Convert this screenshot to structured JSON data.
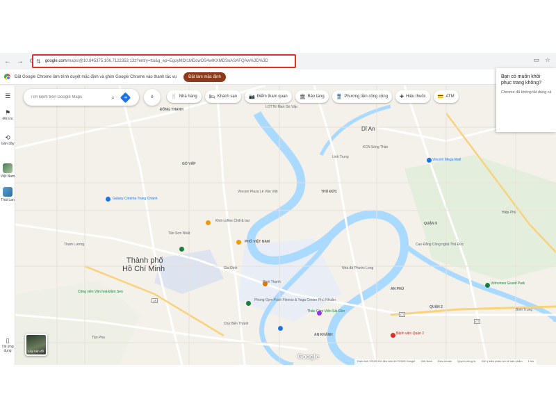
{
  "browser": {
    "url_host": "google.com",
    "url_path": "/maps/@10.845375,106.7122353,13z?entry=ttu&g_ep=EgoyMDI1MDcwOS4wIKXMDSoASAFQAw%3D%3D",
    "back_icon": "back-arrow",
    "forward_icon": "forward-arrow",
    "reload_icon": "reload",
    "site_info_icon": "tune"
  },
  "infobar": {
    "message": "Đặt Google Chrome làm trình duyệt mặc định và ghim Google Chrome vào thanh tác vụ",
    "cta_label": "Đặt làm mặc định"
  },
  "rail": {
    "menu_icon": "hamburger",
    "items": [
      {
        "label": "Đã lưu",
        "icon": "bookmark"
      },
      {
        "label": "Gần đây",
        "icon": "history"
      },
      {
        "label": "Việt Nam",
        "icon": "thumbnail"
      },
      {
        "label": "Thái Lan",
        "icon": "thumbnail"
      },
      {
        "label": "Tải ứng dụng",
        "icon": "phone"
      }
    ]
  },
  "search": {
    "placeholder": "Tìm kiếm trên Google Maps",
    "lang_chip": "ê"
  },
  "chips": [
    {
      "label": "Nhà hàng",
      "icon": "🍴"
    },
    {
      "label": "Khách sạn",
      "icon": "🛏"
    },
    {
      "label": "Điểm tham quan",
      "icon": "📷"
    },
    {
      "label": "Bảo tàng",
      "icon": "🏛"
    },
    {
      "label": "Phương tiện công cộng",
      "icon": "🚆"
    },
    {
      "label": "Hiệu thuốc",
      "icon": "✚"
    },
    {
      "label": "ATM",
      "icon": "💳"
    }
  ],
  "popup": {
    "title": "Bạn có muốn khôi phục trang không?",
    "desc": "Chrome đã không tắt đúng cách"
  },
  "layers_label": "Lớp bản đồ",
  "google_logo": "Google",
  "footer": [
    "Hình ảnh ©2025 Dữ liệu bản đồ ©2025 Google",
    "Việt Nam",
    "Điều khoản",
    "Quyền riêng tư",
    "Gửi ý kiến phản hồi về sản phẩm",
    "1 km"
  ],
  "map_labels": {
    "city": "Thành phố",
    "city2": "Hồ Chí Minh",
    "dian": "Dĩ An",
    "dong_thanh": "ĐÔNG THẠNH",
    "an_khanh": "AN KHÁNH",
    "lotte": "LOTTE Mart Gò Vấp",
    "phoviet": "PHỐ VIỆT NAM",
    "khoi": "Khói coffee Chill & bar",
    "galaxy": "Galaxy Cinema Trung Chánh",
    "vincom": "Vincom Plaza Lê Văn Việt",
    "phongdym": "Phong Gym Push Fitness & Yoga Center Phú Nhuận",
    "thaocam": "Thảo Cầm Viên Sài Gòn",
    "chodan": "Chợ Bến Thành",
    "benh_vien": "Bệnh viện Quận 2",
    "vinhomes": "Vinhomes Grand Park",
    "quan9": "QUẬN 9",
    "quan2": "QUẬN 2",
    "binhtrung": "Binh Trung",
    "gd_phu": "Gia Định",
    "tan_son": "Tân Sơn Nhất",
    "cao_dang": "Cao Đẳng Công nghệ Thủ Đức",
    "hiep_phu": "Hiệp Phú",
    "cv_dong": "Công viên Văn hoá Đầm Sen",
    "tham_luong": "Tham Lương",
    "nha_da": "Nhà đá Phước Long",
    "kcn": "KCN Sóng Thần",
    "binh_thanh": "Bình Thạnh",
    "vincom_q9": "Vincom Mega Mall",
    "go_vap": "GÒ VẤP",
    "thu_duc": "THỦ ĐỨC",
    "an_phu": "AN PHÚ",
    "linh_trung": "Linh Trung",
    "tan_phu": "Tân Phú"
  }
}
